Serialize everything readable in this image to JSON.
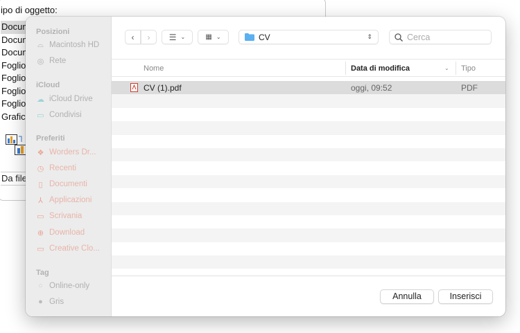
{
  "background_window": {
    "title": "ipo di oggetto:",
    "items": [
      "Docum",
      "Docum",
      "Docum",
      "Foglio",
      "Foglio",
      "Foglio",
      "Foglio",
      "Grafic"
    ],
    "from_file": "Da file"
  },
  "sidebar": {
    "sections": [
      {
        "label": "Posizioni",
        "items": [
          {
            "label": "Macintosh HD",
            "icon": "disk-icon"
          },
          {
            "label": "Rete",
            "icon": "globe-icon"
          }
        ]
      },
      {
        "label": "iCloud",
        "items": [
          {
            "label": "iCloud Drive",
            "icon": "cloud-icon"
          },
          {
            "label": "Condivisi",
            "icon": "shared-folder-icon"
          }
        ]
      },
      {
        "label": "Preferiti",
        "items": [
          {
            "label": "Worders Dr...",
            "icon": "dropbox-icon"
          },
          {
            "label": "Recenti",
            "icon": "clock-icon"
          },
          {
            "label": "Documenti",
            "icon": "document-icon"
          },
          {
            "label": "Applicazioni",
            "icon": "applications-icon"
          },
          {
            "label": "Scrivania",
            "icon": "desktop-icon"
          },
          {
            "label": "Download",
            "icon": "download-icon"
          },
          {
            "label": "Creative Clo...",
            "icon": "folder-icon"
          }
        ]
      },
      {
        "label": "Tag",
        "items": [
          {
            "label": "Online-only",
            "icon": "tag-empty-icon"
          },
          {
            "label": "Gris",
            "icon": "tag-gray-icon"
          }
        ]
      }
    ]
  },
  "toolbar": {
    "location": "CV",
    "search_placeholder": "Cerca"
  },
  "columns": {
    "name": "Nome",
    "date": "Data di modifica",
    "type": "Tipo"
  },
  "files": [
    {
      "name": "CV (1).pdf",
      "date": "oggi, 09:52",
      "type": "PDF"
    }
  ],
  "footer": {
    "cancel": "Annulla",
    "insert": "Inserisci"
  },
  "colors": {
    "accent_folder": "#5ab0f0",
    "sidebar_bg": "#ececec",
    "selected_row": "#dcdcdc"
  }
}
